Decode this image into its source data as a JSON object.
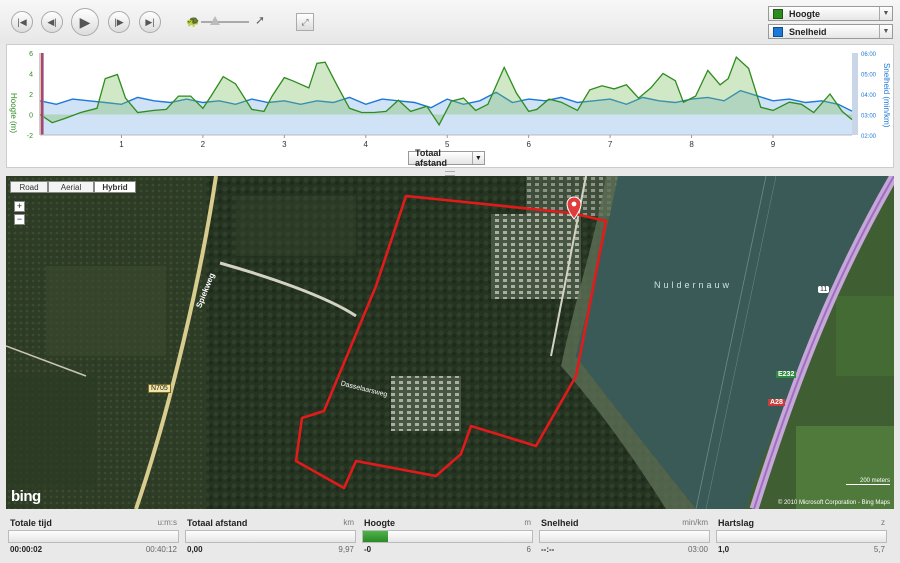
{
  "toolbar": {
    "buttons": [
      "skip-start",
      "rewind",
      "play",
      "fast-forward",
      "skip-end"
    ],
    "speed_slow_icon": "turtle-icon",
    "speed_fast_icon": "hare-icon",
    "fullscreen_icon": "expand-icon",
    "speed_level": 0.3
  },
  "selectors": [
    {
      "label": "Hoogte",
      "color": "#2e8b1f"
    },
    {
      "label": "Snelheid",
      "color": "#1e78d7"
    }
  ],
  "chart": {
    "left_axis_label": "Hoogte (m)",
    "right_axis_label": "Snelheid (min/km)",
    "x_dropdown": "Totaal afstand"
  },
  "chart_data": {
    "type": "area",
    "x_ticks": [
      1,
      2,
      3,
      4,
      5,
      6,
      7,
      8,
      9
    ],
    "y_left_ticks": [
      "6",
      "4",
      "2",
      "0",
      "-2"
    ],
    "y_right_ticks": [
      "06:00",
      "05:00",
      "04:00",
      "03:00",
      "02:00"
    ],
    "xlim": [
      0,
      9.97
    ],
    "ylim_left": [
      -2,
      6
    ],
    "ylim_right": [
      "02:00",
      "06:00"
    ],
    "series": [
      {
        "name": "Hoogte",
        "color": "#2e8b1f",
        "x": [
          0,
          0.15,
          0.3,
          0.5,
          0.7,
          0.8,
          0.95,
          1.05,
          1.2,
          1.4,
          1.55,
          1.7,
          1.85,
          2.0,
          2.1,
          2.25,
          2.4,
          2.6,
          2.75,
          2.85,
          3.0,
          3.1,
          3.3,
          3.4,
          3.5,
          3.65,
          3.8,
          3.95,
          4.1,
          4.25,
          4.4,
          4.55,
          4.75,
          4.9,
          5.05,
          5.2,
          5.35,
          5.5,
          5.7,
          5.85,
          6.0,
          6.1,
          6.25,
          6.4,
          6.6,
          6.75,
          6.9,
          7.05,
          7.2,
          7.35,
          7.5,
          7.65,
          7.8,
          7.9,
          8.05,
          8.2,
          8.35,
          8.45,
          8.55,
          8.7,
          8.85,
          9.0,
          9.2,
          9.35,
          9.5,
          9.7,
          9.85,
          9.97
        ],
        "y": [
          0,
          -0.8,
          -0.4,
          0.2,
          0.6,
          3.5,
          3.9,
          1.6,
          0.2,
          0.4,
          0.5,
          1.8,
          1.8,
          0.6,
          1.8,
          3.7,
          3.0,
          0.5,
          0.3,
          1.8,
          3.6,
          3.3,
          2.6,
          5.0,
          5.1,
          2.8,
          0.6,
          0.2,
          0.2,
          0.3,
          1.4,
          0.3,
          0.8,
          -1.0,
          1.3,
          1.6,
          0.4,
          1.0,
          4.6,
          2.1,
          0.3,
          0.5,
          1.5,
          1.2,
          0.4,
          2.4,
          2.8,
          2.5,
          2.9,
          1.6,
          2.6,
          4.0,
          3.3,
          1.2,
          1.8,
          4.3,
          2.9,
          3.5,
          5.6,
          4.5,
          0.7,
          0.4,
          1.2,
          1.0,
          0.2,
          2.0,
          0.3,
          -0.5
        ]
      },
      {
        "name": "Snelheid",
        "color": "#1e78d7",
        "x": [
          0,
          0.2,
          0.4,
          0.6,
          0.8,
          1.0,
          1.2,
          1.4,
          1.6,
          1.8,
          2.0,
          2.2,
          2.4,
          2.6,
          2.8,
          3.0,
          3.2,
          3.4,
          3.6,
          3.8,
          4.0,
          4.2,
          4.4,
          4.6,
          4.8,
          5.0,
          5.2,
          5.4,
          5.6,
          5.8,
          6.0,
          6.2,
          6.4,
          6.6,
          6.8,
          7.0,
          7.2,
          7.4,
          7.6,
          7.8,
          8.0,
          8.2,
          8.4,
          8.6,
          8.8,
          9.0,
          9.2,
          9.4,
          9.6,
          9.8,
          9.97
        ],
        "y": [
          "03:40",
          "03:30",
          "03:45",
          "03:40",
          "03:35",
          "03:30",
          "03:50",
          "03:40",
          "03:35",
          "03:45",
          "03:35",
          "03:40",
          "03:30",
          "03:45",
          "03:35",
          "03:40",
          "03:30",
          "03:40",
          "03:35",
          "03:50",
          "03:30",
          "03:45",
          "03:40",
          "03:35",
          "03:20",
          "03:45",
          "03:30",
          "03:40",
          "04:05",
          "03:35",
          "03:45",
          "03:40",
          "03:50",
          "03:35",
          "03:40",
          "03:45",
          "03:30",
          "03:50",
          "03:40",
          "03:35",
          "03:45",
          "03:50",
          "03:40",
          "04:10",
          "03:55",
          "03:40",
          "03:45",
          "03:35",
          "03:40",
          "03:30",
          "03:10"
        ]
      }
    ]
  },
  "map": {
    "tabs": [
      "Road",
      "Aerial",
      "Hybrid"
    ],
    "active_tab": "Hybrid",
    "labels": {
      "spiekweg": "Spiekweg",
      "n705": "N705",
      "nuldernauw": "Nuldernauw",
      "dasselaarsweg": "Dasselaarsweg",
      "e232": "E232",
      "a28": "A28",
      "eleven": "11",
      "scale": "200 meters",
      "copyright": "© 2010 Microsoft Corporation - Bing Maps",
      "bing": "bing"
    }
  },
  "stats": [
    {
      "label": "Totale tijd",
      "unit": "u:m:s",
      "value": "00:00:02",
      "max": "00:40:12",
      "fraction": 0
    },
    {
      "label": "Totaal afstand",
      "unit": "km",
      "value": "0,00",
      "max": "9,97",
      "fraction": 0
    },
    {
      "label": "Hoogte",
      "unit": "m",
      "value": "-0",
      "max": "6",
      "fraction": 0.15
    },
    {
      "label": "Snelheid",
      "unit": "min/km",
      "value": "--:--",
      "max": "03:00",
      "fraction": 0
    },
    {
      "label": "Hartslag",
      "unit": "z",
      "value": "1,0",
      "max": "5,7",
      "fraction": 0
    }
  ]
}
